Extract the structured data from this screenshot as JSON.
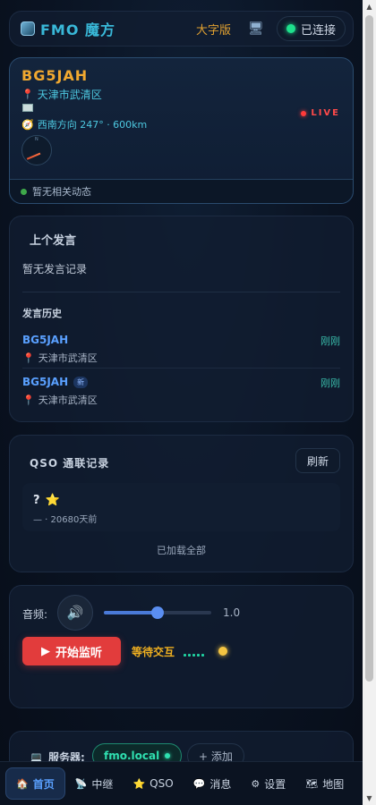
{
  "header": {
    "title": "FMO 魔方",
    "big_font_label": "大字版",
    "connection_status": "已连接"
  },
  "station": {
    "callsign": "BG5JAH",
    "location": "天津市武清区",
    "direction": "西南方向 247° · 600km",
    "live_label": "LIVE",
    "activity": "暂无相关动态"
  },
  "speech": {
    "title": "上个发言",
    "empty_text": "暂无发言记录",
    "history_title": "发言历史",
    "history": [
      {
        "callsign": "BG5JAH",
        "location": "天津市武清区",
        "time": "刚刚",
        "badge": ""
      },
      {
        "callsign": "BG5JAH",
        "location": "天津市武清区",
        "time": "刚刚",
        "badge": "新"
      }
    ]
  },
  "qso": {
    "title": "QSO 通联记录",
    "refresh_label": "刷新",
    "items": [
      {
        "callsign": "?",
        "meta": "— · 20680天前"
      }
    ],
    "loaded_all": "已加载全部"
  },
  "audio": {
    "volume_label": "音频:",
    "volume_value": "1.0",
    "volume_fraction": 0.5,
    "listen_label": "开始监听",
    "wait_label": "等待交互"
  },
  "server": {
    "label": "服务器:",
    "active": "fmo.local",
    "add_label": "+ 添加"
  },
  "nav": [
    {
      "label": "首页",
      "icon": "home-icon"
    },
    {
      "label": "中继",
      "icon": "satellite-icon"
    },
    {
      "label": "QSO",
      "icon": "star-icon"
    },
    {
      "label": "消息",
      "icon": "chat-icon"
    },
    {
      "label": "设置",
      "icon": "gear-icon"
    },
    {
      "label": "地图",
      "icon": "map-icon"
    }
  ]
}
